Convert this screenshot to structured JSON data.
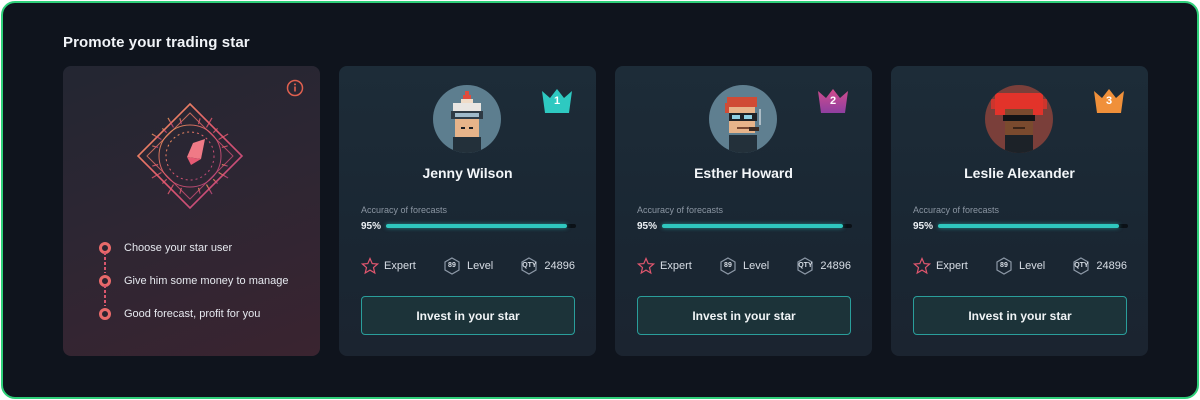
{
  "title": "Promote your trading star",
  "colors": {
    "frame_border": "#2fd07a",
    "background": "#0f141d",
    "accent_teal": "#2fc7bf",
    "step_marker": "#e86a6a"
  },
  "intro": {
    "info_icon": "info-icon",
    "illustration": "star-diamond-icon",
    "steps": [
      {
        "label": "Choose your star user"
      },
      {
        "label": "Give him some money to manage"
      },
      {
        "label": "Good forecast, profit for you"
      }
    ]
  },
  "cards": [
    {
      "rank": "1",
      "rank_color": "#2ec9c1",
      "name": "Jenny Wilson",
      "accuracy_label": "Accuracy of forecasts",
      "accuracy_text": "95%",
      "accuracy_value": 0.95,
      "expert_label": "Expert",
      "level_number": "89",
      "level_label": "Level",
      "qty_badge": "QTY",
      "qty_value": "24896",
      "button_label": "Invest in your star"
    },
    {
      "rank": "2",
      "rank_color": "#c24b92",
      "name": "Esther Howard",
      "accuracy_label": "Accuracy of forecasts",
      "accuracy_text": "95%",
      "accuracy_value": 0.95,
      "expert_label": "Expert",
      "level_number": "89",
      "level_label": "Level",
      "qty_badge": "QTY",
      "qty_value": "24896",
      "button_label": "Invest in your star"
    },
    {
      "rank": "3",
      "rank_color": "#f0903a",
      "name": "Leslie Alexander",
      "accuracy_label": "Accuracy of forecasts",
      "accuracy_text": "95%",
      "accuracy_value": 0.95,
      "expert_label": "Expert",
      "level_number": "89",
      "level_label": "Level",
      "qty_badge": "QTY",
      "qty_value": "24896",
      "button_label": "Invest in your star"
    }
  ]
}
